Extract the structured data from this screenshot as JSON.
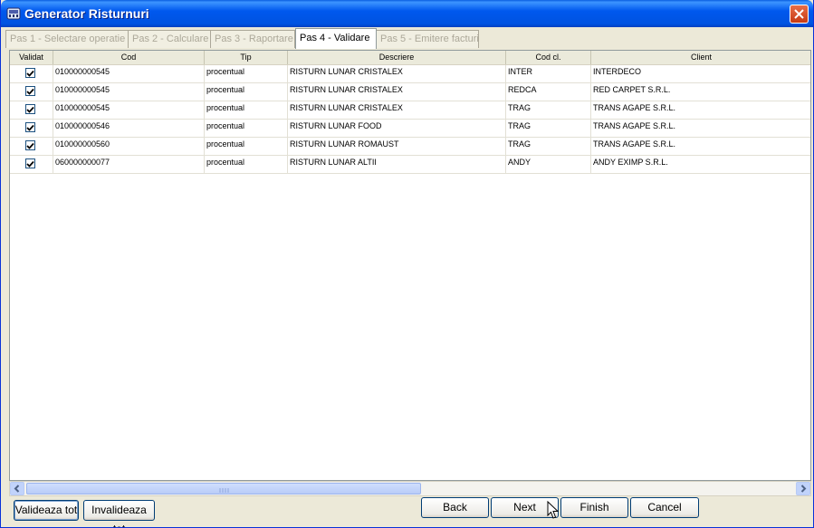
{
  "window": {
    "title": "Generator Risturnuri"
  },
  "tabs": [
    {
      "label": "Pas 1 - Selectare operatie"
    },
    {
      "label": "Pas 2 - Calculare"
    },
    {
      "label": "Pas 3 - Raportare"
    },
    {
      "label": "Pas 4 - Validare"
    },
    {
      "label": "Pas 5 - Emitere facturi"
    }
  ],
  "active_tab": "Pas 4 - Validare",
  "grid": {
    "columns": [
      "Validat",
      "Cod",
      "Tip",
      "Descriere",
      "Cod cl.",
      "Client"
    ],
    "rows": [
      {
        "validat": true,
        "cod": "010000000545",
        "tip": "procentual",
        "descriere": "RISTURN LUNAR CRISTALEX",
        "cod_cl": "INTER",
        "client": "INTERDECO"
      },
      {
        "validat": true,
        "cod": "010000000545",
        "tip": "procentual",
        "descriere": "RISTURN LUNAR CRISTALEX",
        "cod_cl": "REDCA",
        "client": "RED CARPET S.R.L."
      },
      {
        "validat": true,
        "cod": "010000000545",
        "tip": "procentual",
        "descriere": "RISTURN LUNAR CRISTALEX",
        "cod_cl": "TRAG",
        "client": "TRANS AGAPE S.R.L."
      },
      {
        "validat": true,
        "cod": "010000000546",
        "tip": "procentual",
        "descriere": "RISTURN LUNAR FOOD",
        "cod_cl": "TRAG",
        "client": "TRANS AGAPE S.R.L."
      },
      {
        "validat": true,
        "cod": "010000000560",
        "tip": "procentual",
        "descriere": "RISTURN LUNAR ROMAUST",
        "cod_cl": "TRAG",
        "client": "TRANS AGAPE S.R.L."
      },
      {
        "validat": true,
        "cod": "060000000077",
        "tip": "procentual",
        "descriere": "RISTURN LUNAR ALTII",
        "cod_cl": "ANDY",
        "client": "ANDY EXIMP S.R.L."
      }
    ]
  },
  "buttons": {
    "validate_all": "Valideaza tot",
    "invalidate_all": "Invalideaza tot",
    "back": "Back",
    "next": "Next",
    "finish": "Finish",
    "cancel": "Cancel"
  },
  "icons": {
    "app": "app-window-icon",
    "close": "close-icon",
    "check": "checkmark-icon"
  },
  "colors": {
    "titlebar": "#0058EE",
    "close": "#D7532A",
    "window_bg": "#ECE9D8"
  }
}
